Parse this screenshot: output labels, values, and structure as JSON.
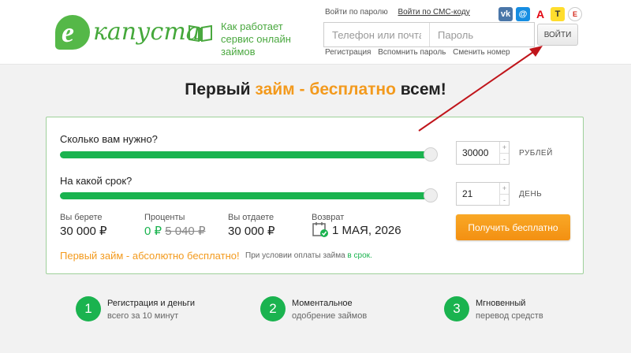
{
  "brand": {
    "logo_letter": "е",
    "logo_text": "капуста"
  },
  "header": {
    "how_works": [
      "Как работает",
      "сервис онлайн займов"
    ],
    "login_modes": {
      "password": "Войти по паролю",
      "sms": "Войти по СМС-коду"
    },
    "phone_placeholder": "Телефон или почта",
    "password_placeholder": "Пароль",
    "login_button": "ВОЙТИ",
    "links": {
      "register": "Регистрация",
      "remember": "Вспомнить пароль",
      "change": "Сменить номер"
    },
    "social": [
      {
        "icon": "vk-icon",
        "glyph": "vk",
        "color": "#4a76a8"
      },
      {
        "icon": "mailru-icon",
        "glyph": "@",
        "color": "#168de2"
      },
      {
        "icon": "alfa-bank-icon",
        "glyph": "А",
        "color": "#e30611"
      },
      {
        "icon": "tinkoff-icon",
        "glyph": "T",
        "color": "#ffdd2d"
      },
      {
        "icon": "gosuslugi-icon",
        "glyph": "Е",
        "color": "#d52b1e"
      }
    ]
  },
  "headline": {
    "before": "Первый ",
    "highlight": "займ - бесплатно",
    "after": " всем!"
  },
  "calculator": {
    "amount_question": "Сколько вам нужно?",
    "amount_value": "30000",
    "amount_unit": "РУБЛЕЙ",
    "amount_fill": 1.0,
    "term_question": "На какой срок?",
    "term_value": "21",
    "term_unit": "ДЕНЬ",
    "term_fill": 1.0,
    "spin_plus": "+",
    "spin_minus": "-",
    "take_label": "Вы берете",
    "take_value": "30 000 ₽",
    "interest_label": "Проценты",
    "interest_value": "0 ₽",
    "interest_old": "5 040 ₽",
    "return_label": "Вы отдаете",
    "return_value": "30 000 ₽",
    "due_label": "Возврат",
    "due_value": "1 МАЯ, 2026",
    "get_button": "Получить бесплатно",
    "promo": "Первый займ - абсолютно бесплатно!",
    "promo_note": "При условии оплаты займа ",
    "promo_note_link": "в срок."
  },
  "steps": [
    {
      "num": "1",
      "title": "Регистрация и деньги",
      "sub": "всего за 10 минут"
    },
    {
      "num": "2",
      "title": "Моментальное",
      "sub": "одобрение займов"
    },
    {
      "num": "3",
      "title": "Мгновенный",
      "sub": "перевод средств"
    }
  ],
  "colors": {
    "green": "#1ab34f",
    "orange": "#f39a1d",
    "arrow": "#c0151b"
  }
}
